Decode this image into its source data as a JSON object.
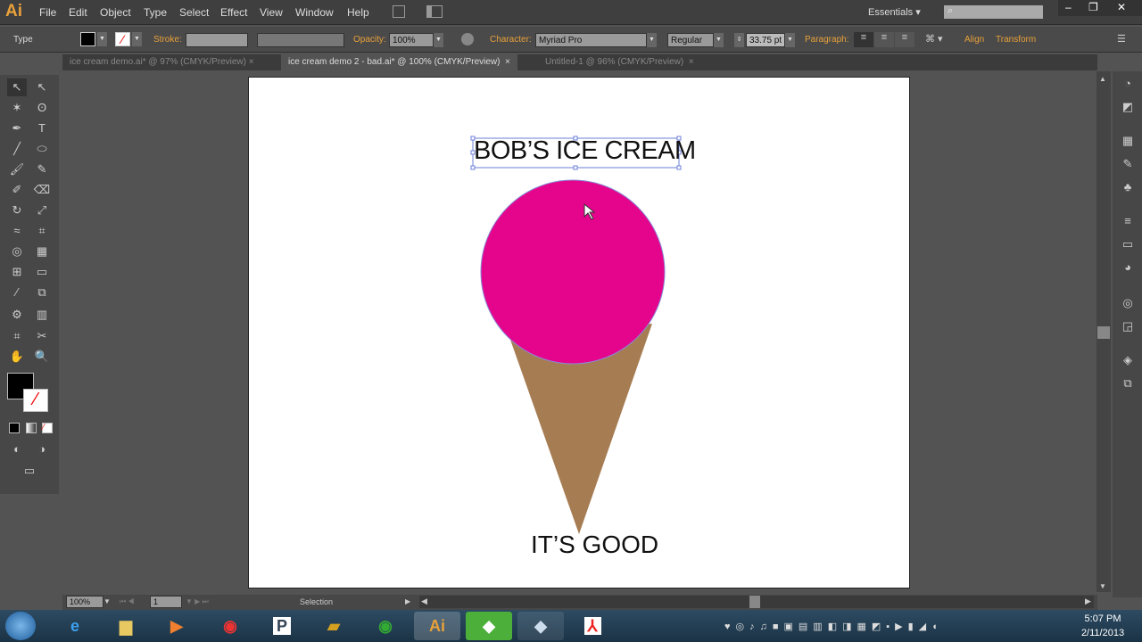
{
  "app": {
    "logo": "Ai",
    "menus": [
      "File",
      "Edit",
      "Object",
      "Type",
      "Select",
      "Effect",
      "View",
      "Window",
      "Help"
    ],
    "workspace": "Essentials",
    "search_placeholder": ""
  },
  "control": {
    "tool_label": "Type",
    "stroke_label": "Stroke:",
    "opacity_label": "Opacity:",
    "opacity": "100%",
    "character_label": "Character:",
    "font": "Myriad Pro",
    "style": "Regular",
    "size": "33.75 pt",
    "paragraph_label": "Paragraph:",
    "align_label": "Align",
    "transform_label": "Transform"
  },
  "tabs": [
    {
      "label": "ice cream demo.ai* @ 97% (CMYK/Preview)",
      "active": false
    },
    {
      "label": "ice cream demo 2 - bad.ai* @ 100% (CMYK/Preview)",
      "active": true
    },
    {
      "label": "Untitled-1 @ 96% (CMYK/Preview)",
      "active": false
    }
  ],
  "artwork": {
    "title": "BOB’S ICE CREAM",
    "tagline": "IT’S GOOD",
    "scoop_color": "#e5058c",
    "cone_color": "#a67c52"
  },
  "status": {
    "zoom": "100%",
    "page": "1",
    "mode": "Selection"
  },
  "clock": {
    "time": "5:07 PM",
    "date": "2/11/2013"
  }
}
